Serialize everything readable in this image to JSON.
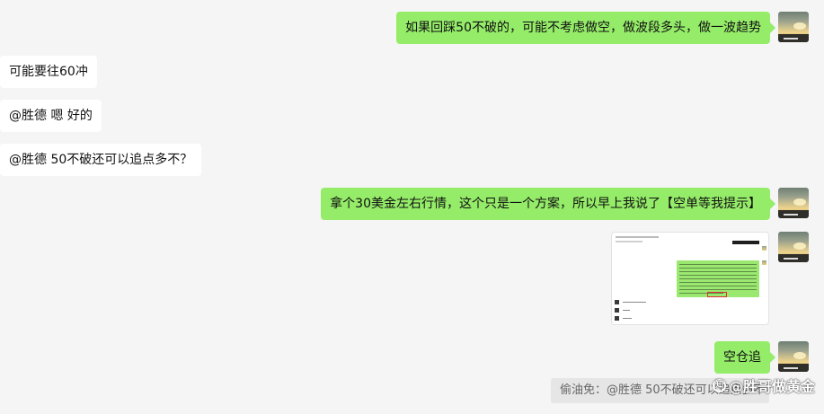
{
  "messages": [
    {
      "direction": "outgoing",
      "text": "如果回踩50不破的，可能不考虑做空，做波段多头，做一波趋势"
    },
    {
      "direction": "incoming",
      "text": "可能要往60冲"
    },
    {
      "direction": "incoming",
      "text": "@胜德 嗯 好的"
    },
    {
      "direction": "incoming",
      "text": "@胜德 50不破还可以追点多不？"
    },
    {
      "direction": "outgoing",
      "text": "拿个30美金左右行情，这个只是一个方案，所以早上我说了【空单等我提示】"
    },
    {
      "direction": "outgoing",
      "type": "image",
      "description_icon": "screenshot-thumbnail"
    },
    {
      "direction": "outgoing",
      "text": "空仓追"
    }
  ],
  "quote": {
    "text": "偷油免：@胜德 50不破还可以追点多不？"
  },
  "watermark": {
    "text": "知乎 @胜哥做黄金"
  },
  "colors": {
    "background": "#f5f5f5",
    "outgoing_bubble": "#95ec69",
    "incoming_bubble": "#ffffff",
    "quote_background": "#e6e6e6"
  }
}
